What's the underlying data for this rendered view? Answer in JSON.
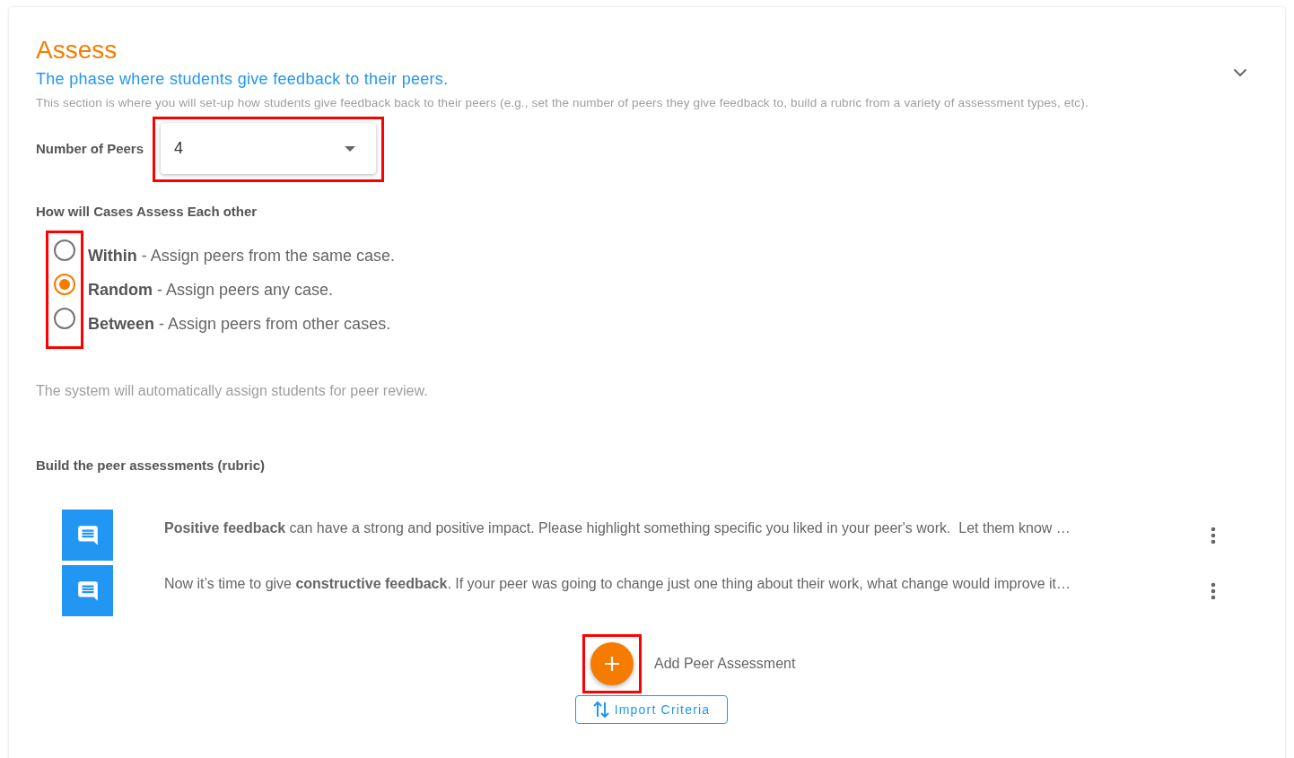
{
  "section": {
    "title": "Assess",
    "subtitle": "The phase where students give feedback to their peers.",
    "description": "This section is where you will set-up how students give feedback back to their peers (e.g., set the number of peers they give feedback to, build a rubric from a variety of assessment types, etc).",
    "expanded": true
  },
  "peers": {
    "label": "Number of Peers",
    "value": "4",
    "highlighted": true
  },
  "assess_mode": {
    "heading": "How will Cases Assess Each other",
    "highlighted": true,
    "options": [
      {
        "name": "Within",
        "description": " - Assign peers from the same case.",
        "selected": false
      },
      {
        "name": "Random",
        "description": " - Assign peers any case.",
        "selected": true
      },
      {
        "name": "Between",
        "description": " - Assign peers from other cases.",
        "selected": false
      }
    ],
    "note": "The system will automatically assign students for peer review."
  },
  "rubric": {
    "heading": "Build the peer assessments (rubric)",
    "items": [
      {
        "kind": "comment",
        "text": "**Positive feedback** can have a strong and positive impact. Please highlight something specific you liked in your peer's work.  Let them know …"
      },
      {
        "kind": "comment",
        "text": "Now it’s time to give **constructive feedback**. If your peer was going to change just one thing about their work, what change would improve it…"
      }
    ],
    "add_label": "Add Peer Assessment",
    "add_highlighted": true,
    "import_label": "Import Criteria"
  }
}
